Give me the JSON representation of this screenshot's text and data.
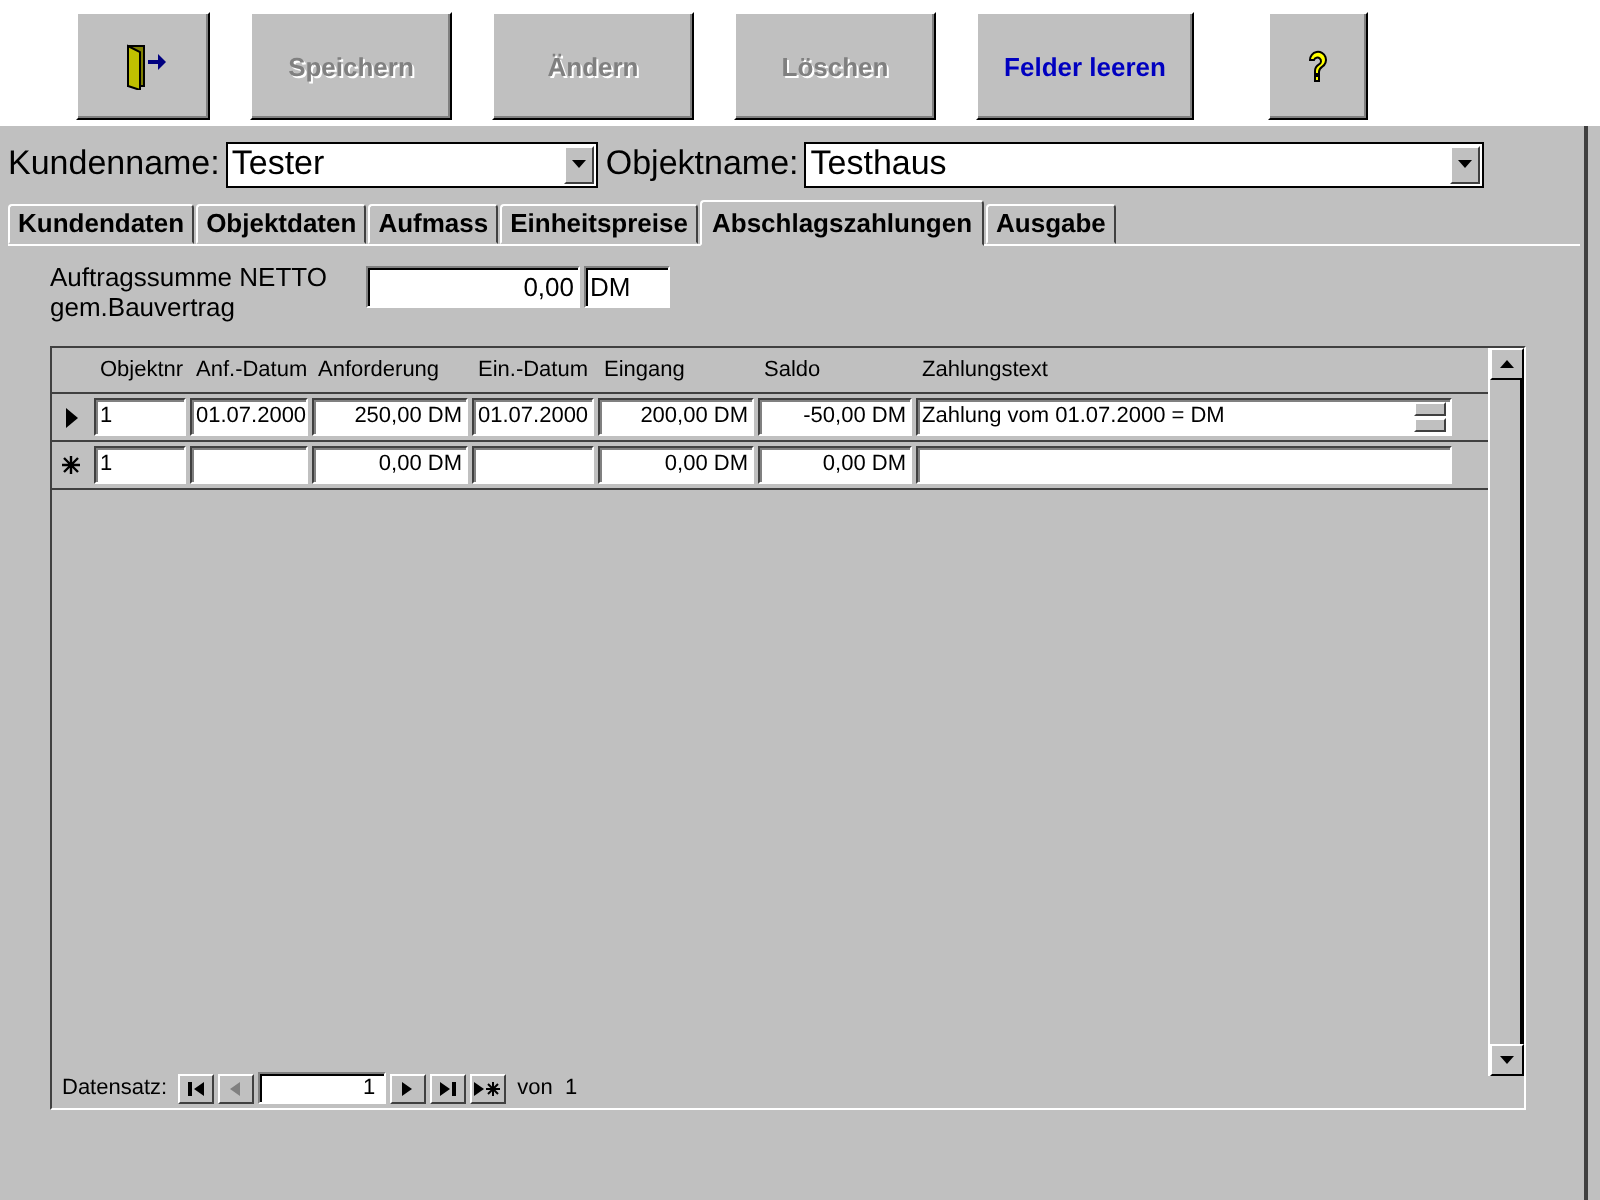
{
  "toolbar": [
    {
      "kind": "icon"
    },
    {
      "kind": "text",
      "label": "Speichern",
      "disabled": true
    },
    {
      "kind": "text",
      "label": "Ändern",
      "disabled": true
    },
    {
      "kind": "text",
      "label": "Löschen",
      "disabled": true
    },
    {
      "kind": "text",
      "label": "Felder leeren",
      "disabled": false
    },
    {
      "kind": "icon"
    }
  ],
  "kunde": {
    "label": "Kundenname:",
    "value": "Tester"
  },
  "objekt": {
    "label": "Objektname:",
    "value": "Testhaus"
  },
  "tabs": [
    {
      "label": "Kundendaten",
      "selected": false
    },
    {
      "label": "Objektdaten",
      "selected": false
    },
    {
      "label": "Aufmass",
      "selected": false
    },
    {
      "label": "Einheitspreise",
      "selected": false
    },
    {
      "label": "Abschlagszahlungen",
      "selected": true
    },
    {
      "label": "Ausgabe",
      "selected": false
    }
  ],
  "summe": {
    "label_lines": [
      "Auftragssumme NETTO",
      "gem.Bauvertrag"
    ],
    "value": "0,00",
    "unit": "DM"
  },
  "table": {
    "columns": [
      "Objektnr",
      "Anf.-Datum",
      "Anforderung",
      "Ein.-Datum",
      "Eingang",
      "Saldo",
      "Zahlungstext"
    ],
    "rows": [
      {
        "selected": true,
        "cells": [
          "1",
          "01.07.2000",
          "250,00 DM",
          "01.07.2000",
          "200,00 DM",
          "-50,00 DM",
          "Zahlung vom 01.07.2000 = DM"
        ]
      },
      {
        "selected": false,
        "cells": [
          "1",
          "",
          "0,00 DM",
          "",
          "0,00 DM",
          "0,00 DM",
          ""
        ]
      }
    ]
  },
  "navigation": {
    "label": "Datensatz:",
    "record": "1",
    "of": "von  1"
  }
}
